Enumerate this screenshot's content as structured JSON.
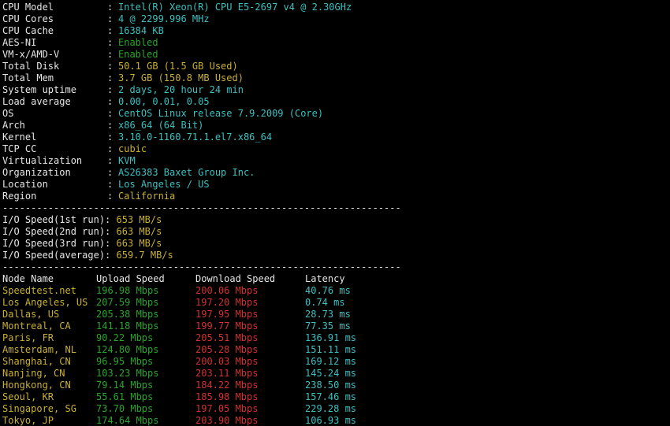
{
  "colors": {
    "label": "#e6e6e6",
    "cyan": "#3cc0c0",
    "green": "#2aa52a",
    "yellow": "#c9b030",
    "red": "#d43030",
    "background": "#000000"
  },
  "sysinfo": [
    {
      "label": "CPU Model",
      "value": "Intel(R) Xeon(R) CPU E5-2697 v4 @ 2.30GHz",
      "color": "#3cc0c0"
    },
    {
      "label": "CPU Cores",
      "value": "4 @ 2299.996 MHz",
      "color": "#3cc0c0"
    },
    {
      "label": "CPU Cache",
      "value": "16384 KB",
      "color": "#3cc0c0"
    },
    {
      "label": "AES-NI",
      "value": "Enabled",
      "color": "#2aa52a"
    },
    {
      "label": "VM-x/AMD-V",
      "value": "Enabled",
      "color": "#2aa52a"
    },
    {
      "label": "Total Disk",
      "value": "50.1 GB (1.5 GB Used)",
      "color": "#c9b030"
    },
    {
      "label": "Total Mem",
      "value": "3.7 GB (150.8 MB Used)",
      "color": "#c9b030"
    },
    {
      "label": "System uptime",
      "value": "2 days, 20 hour 24 min",
      "color": "#3cc0c0"
    },
    {
      "label": "Load average",
      "value": "0.00, 0.01, 0.05",
      "color": "#3cc0c0"
    },
    {
      "label": "OS",
      "value": "CentOS Linux release 7.9.2009 (Core)",
      "color": "#3cc0c0"
    },
    {
      "label": "Arch",
      "value": "x86_64 (64 Bit)",
      "color": "#3cc0c0"
    },
    {
      "label": "Kernel",
      "value": "3.10.0-1160.71.1.el7.x86_64",
      "color": "#3cc0c0"
    },
    {
      "label": "TCP CC",
      "value": "cubic",
      "color": "#c9b030"
    },
    {
      "label": "Virtualization",
      "value": "KVM",
      "color": "#3cc0c0"
    },
    {
      "label": "Organization",
      "value": "AS26383 Baxet Group Inc.",
      "color": "#3cc0c0"
    },
    {
      "label": "Location",
      "value": "Los Angeles / US",
      "color": "#3cc0c0"
    },
    {
      "label": "Region",
      "value": "California",
      "color": "#c9b030"
    }
  ],
  "separator": "----------------------------------------------------------------------",
  "io": [
    {
      "label": "I/O Speed(1st run)",
      "value": "653 MB/s"
    },
    {
      "label": "I/O Speed(2nd run)",
      "value": "663 MB/s"
    },
    {
      "label": "I/O Speed(3rd run)",
      "value": "663 MB/s"
    },
    {
      "label": "I/O Speed(average)",
      "value": "659.7 MB/s"
    }
  ],
  "io_colon": ": ",
  "colon": ":",
  "speed_header": {
    "node": "Node Name",
    "upload": "Upload Speed",
    "download": "Download Speed",
    "latency": "Latency"
  },
  "speedtest": [
    {
      "node": "Speedtest.net",
      "upload": "196.98 Mbps",
      "download": "200.06 Mbps",
      "latency": "40.76 ms"
    },
    {
      "node": "Los Angeles, US",
      "upload": "207.59 Mbps",
      "download": "197.20 Mbps",
      "latency": "0.74 ms"
    },
    {
      "node": "Dallas, US",
      "upload": "205.38 Mbps",
      "download": "197.95 Mbps",
      "latency": "28.73 ms"
    },
    {
      "node": "Montreal, CA",
      "upload": "141.18 Mbps",
      "download": "199.77 Mbps",
      "latency": "77.35 ms"
    },
    {
      "node": "Paris, FR",
      "upload": "90.22 Mbps",
      "download": "205.51 Mbps",
      "latency": "136.91 ms"
    },
    {
      "node": "Amsterdam, NL",
      "upload": "124.80 Mbps",
      "download": "205.28 Mbps",
      "latency": "151.11 ms"
    },
    {
      "node": "Shanghai, CN",
      "upload": "96.95 Mbps",
      "download": "200.03 Mbps",
      "latency": "169.12 ms"
    },
    {
      "node": "Nanjing, CN",
      "upload": "103.23 Mbps",
      "download": "203.11 Mbps",
      "latency": "145.24 ms"
    },
    {
      "node": "Hongkong, CN",
      "upload": "79.14 Mbps",
      "download": "184.22 Mbps",
      "latency": "238.50 ms"
    },
    {
      "node": "Seoul, KR",
      "upload": "55.61 Mbps",
      "download": "185.98 Mbps",
      "latency": "157.46 ms"
    },
    {
      "node": "Singapore, SG",
      "upload": "73.70 Mbps",
      "download": "197.05 Mbps",
      "latency": "229.28 ms"
    },
    {
      "node": "Tokyo, JP",
      "upload": "174.64 Mbps",
      "download": "203.90 Mbps",
      "latency": "106.93 ms"
    }
  ]
}
